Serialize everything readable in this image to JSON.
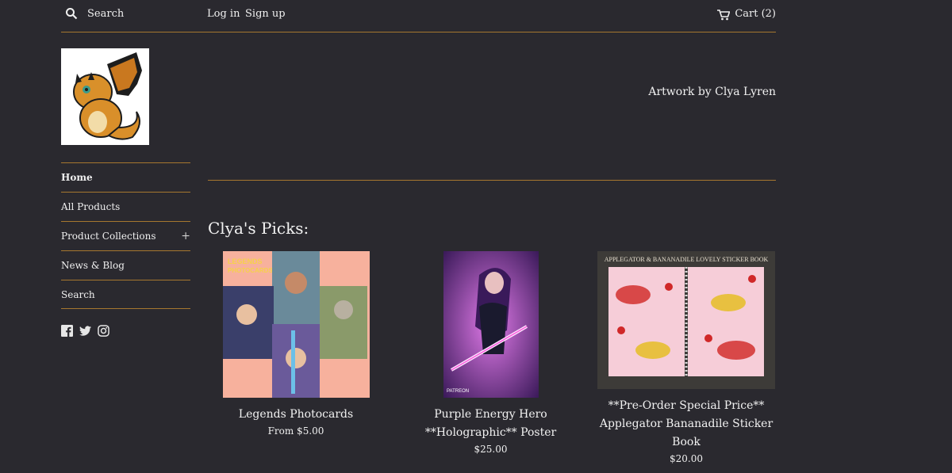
{
  "header": {
    "search_label": "Search",
    "login_label": "Log in",
    "signup_label": "Sign up",
    "cart_label": "Cart (2)"
  },
  "store": {
    "tagline": "Artwork by Clya Lyren"
  },
  "sidebar": {
    "items": [
      {
        "label": "Home"
      },
      {
        "label": "All Products"
      },
      {
        "label": "Product Collections",
        "expander": "+"
      },
      {
        "label": "News & Blog"
      },
      {
        "label": "Search"
      }
    ],
    "social": [
      "facebook-icon",
      "twitter-icon",
      "instagram-icon"
    ]
  },
  "picks": {
    "title": "Clya's Picks:",
    "products": [
      {
        "name": "Legends Photocards",
        "price": "From $5.00",
        "image_text": "LEGENDS PHOTOCARDS"
      },
      {
        "name": "Purple Energy Hero **Holographic** Poster",
        "price": "$25.00",
        "image_text": "PATREON CLYALYREN"
      },
      {
        "name": "**Pre-Order Special Price** Applegator Bananadile Sticker Book",
        "price": "$20.00",
        "image_text": "Applegator & Bananadile Lovely Sticker Book"
      }
    ]
  },
  "colors": {
    "background": "#2a292f",
    "divider": "#a6772f",
    "text": "#e6e6e6"
  }
}
